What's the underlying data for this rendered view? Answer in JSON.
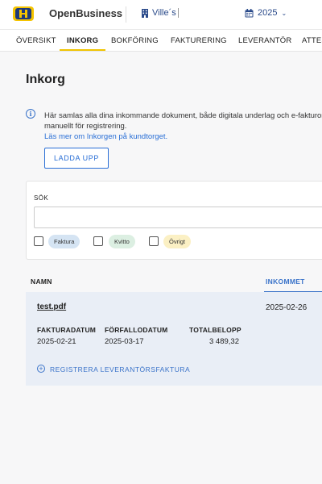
{
  "header": {
    "brand": "OpenBusiness",
    "company": "Ville´s",
    "year": "2025",
    "colors": {
      "logo_yellow": "#f5c400",
      "logo_navy": "#1f3a7a",
      "accent_blue": "#2a6fd6",
      "tab_underline": "#f0c400"
    }
  },
  "tabs": [
    {
      "label": "ÖVERSIKT"
    },
    {
      "label": "INKORG"
    },
    {
      "label": "BOKFÖRING"
    },
    {
      "label": "FAKTURERING"
    },
    {
      "label": "LEVERANTÖR"
    },
    {
      "label": "ATTES"
    }
  ],
  "page": {
    "title": "Inkorg",
    "info_line1": "Här samlas alla dina inkommande dokument, både digitala underlag och e-fakturor",
    "info_line2": "manuellt för registrering.",
    "info_link": "Läs mer om Inkorgen på kundtorget.",
    "upload_label": "LADDA UPP"
  },
  "search": {
    "label": "SÖK",
    "value": "",
    "filters": [
      {
        "label": "Faktura",
        "color": "#d5e4f3"
      },
      {
        "label": "Kvitto",
        "color": "#dcefe2"
      },
      {
        "label": "Övrigt",
        "color": "#fbf0c4"
      }
    ]
  },
  "list": {
    "col_name": "NAMN",
    "col_received": "INKOMMET",
    "items": [
      {
        "name": "test.pdf",
        "received": "2025-02-26",
        "invoice_date_label": "FAKTURADATUM",
        "invoice_date": "2025-02-21",
        "due_date_label": "FÖRFALLODATUM",
        "due_date": "2025-03-17",
        "total_label": "TOTALBELOPP",
        "total": "3 489,32",
        "register_label": "REGISTRERA LEVERANTÖRSFAKTURA"
      }
    ]
  }
}
